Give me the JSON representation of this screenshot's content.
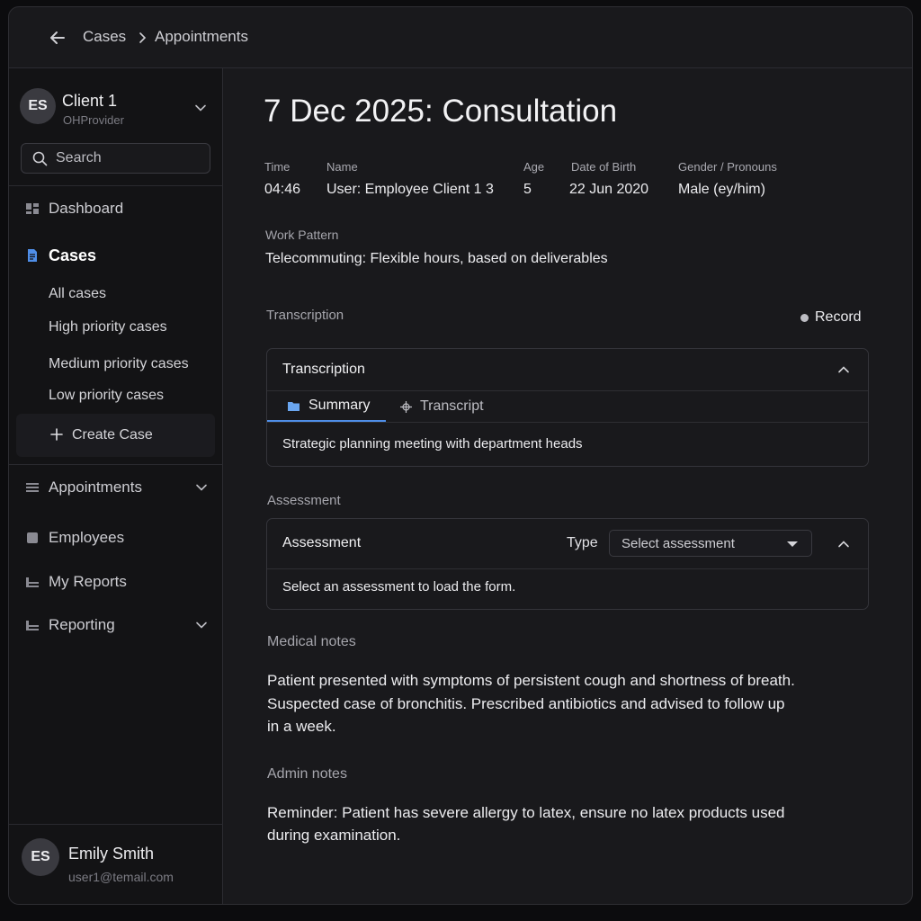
{
  "breadcrumb": {
    "items": [
      "Cases",
      "Appointments"
    ]
  },
  "sidebar": {
    "client": {
      "initials": "ES",
      "name": "Client 1",
      "subtitle": "OHProvider"
    },
    "search_placeholder": "Search",
    "nav": {
      "dashboard": "Dashboard",
      "cases": "Cases",
      "cases_sub": [
        "All cases",
        "High priority cases",
        "Medium priority cases",
        "Low priority cases"
      ],
      "create_case": "Create Case",
      "appointments": "Appointments",
      "employees": "Employees",
      "my_reports": "My Reports",
      "reporting": "Reporting"
    },
    "user": {
      "initials": "ES",
      "name": "Emily Smith",
      "email": "user1@temail.com"
    }
  },
  "page": {
    "title": "7 Dec 2025: Consultation",
    "meta": {
      "time_label": "Time",
      "time": "04:46",
      "name_label": "Name",
      "name": "User: Employee Client 1 3",
      "age_label": "Age",
      "age": "5",
      "dob_label": "Date of Birth",
      "dob": "22 Jun 2020",
      "gender_label": "Gender / Pronouns",
      "gender": "Male (ey/him)"
    },
    "work_pattern_label": "Work Pattern",
    "work_pattern": "Telecommuting: Flexible hours, based on deliverables",
    "transcription": {
      "section_label": "Transcription",
      "record_label": "Record",
      "panel_title": "Transcription",
      "tabs": [
        "Summary",
        "Transcript"
      ],
      "content": "Strategic planning meeting with department heads"
    },
    "assessment": {
      "section_label": "Assessment",
      "panel_title": "Assessment",
      "type_label": "Type",
      "select_value": "Select an assessment",
      "select_placeholder": "Select assessment",
      "content": "Select an assessment to load the form."
    },
    "medical_notes_label": "Medical notes",
    "medical_notes": [
      "Patient presented with symptoms of persistent cough and shortness of breath.",
      "Suspected case of bronchitis. Prescribed antibiotics and advised to follow up",
      "in a week."
    ],
    "admin_notes_label": "Admin notes",
    "admin_notes": [
      "Reminder: Patient has severe allergy to latex, ensure no latex products used",
      "during examination."
    ]
  },
  "colors": {
    "accent": "#4f8ee8",
    "background": "#19191c",
    "sidebar": "#131315"
  }
}
